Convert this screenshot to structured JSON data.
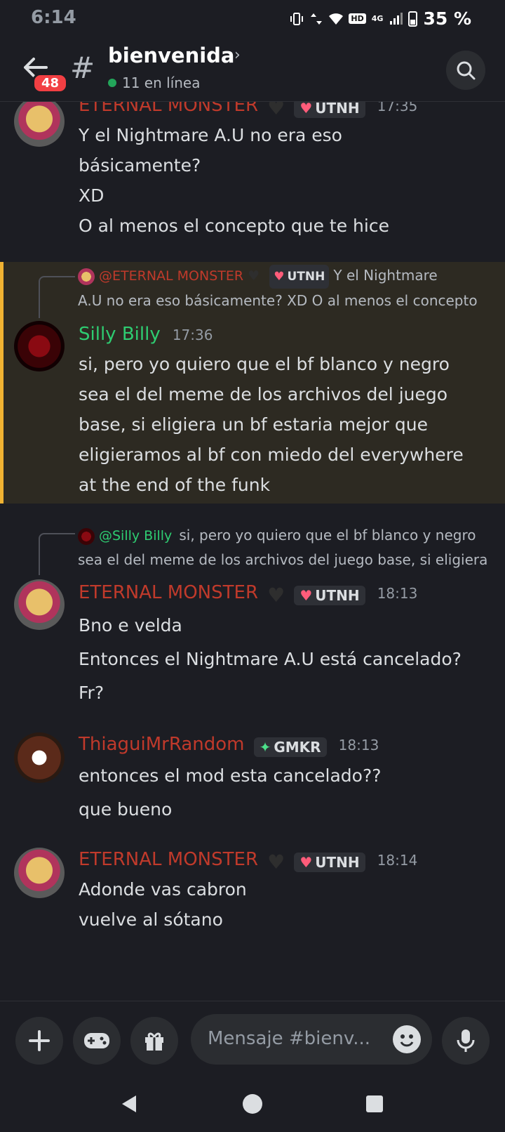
{
  "status": {
    "time": "6:14",
    "battery": "35 %",
    "network": "4G",
    "hd": "HD"
  },
  "header": {
    "channel": "bienvenida",
    "online": "11 en línea",
    "back_badge": "48"
  },
  "messages": [
    {
      "author": "ETERNAL MONSTER",
      "role": "UTNH",
      "time": "17:35",
      "lines": [
        "Y el Nightmare A.U no era eso",
        "básicamente?",
        "XD",
        "O al menos el concepto que te hice"
      ]
    },
    {
      "reply_author": "@ETERNAL MONSTER",
      "reply_role": "UTNH",
      "reply_text_1": "Y el Nightmare",
      "reply_text_2": "A.U no era eso básicamente? XD O al menos el concepto",
      "author": "Silly Billy",
      "time": "17:36",
      "lines": [
        "si, pero yo quiero que el bf blanco y negro",
        "sea el del meme de los archivos del juego",
        "base, si eligiera un bf estaria mejor que",
        "eligieramos al bf con miedo del everywhere",
        "at the end of the funk"
      ]
    },
    {
      "reply_author": "@Silly Billy",
      "reply_text_1": "si, pero yo quiero que el bf blanco y negro",
      "reply_text_2": "sea el del meme de los archivos del juego base, si eligiera",
      "author": "ETERNAL MONSTER",
      "role": "UTNH",
      "time": "18:13",
      "lines": [
        "Bno e velda",
        "Entonces el Nightmare A.U está cancelado?",
        "Fr?"
      ]
    },
    {
      "author": "ThiaguiMrRandom",
      "role": "GMKR",
      "time": "18:13",
      "lines": [
        "entonces el mod esta cancelado??",
        "que bueno"
      ]
    },
    {
      "author": "ETERNAL MONSTER",
      "role": "UTNH",
      "time": "18:14",
      "lines": [
        "Adonde vas cabron",
        "vuelve al sótano"
      ]
    }
  ],
  "composer": {
    "placeholder": "Mensaje #bienv..."
  },
  "colors": {
    "monster": "#c03a2b",
    "silly": "#2ecc71",
    "thiagui": "#c0392b",
    "highlight": "#f0b232"
  }
}
